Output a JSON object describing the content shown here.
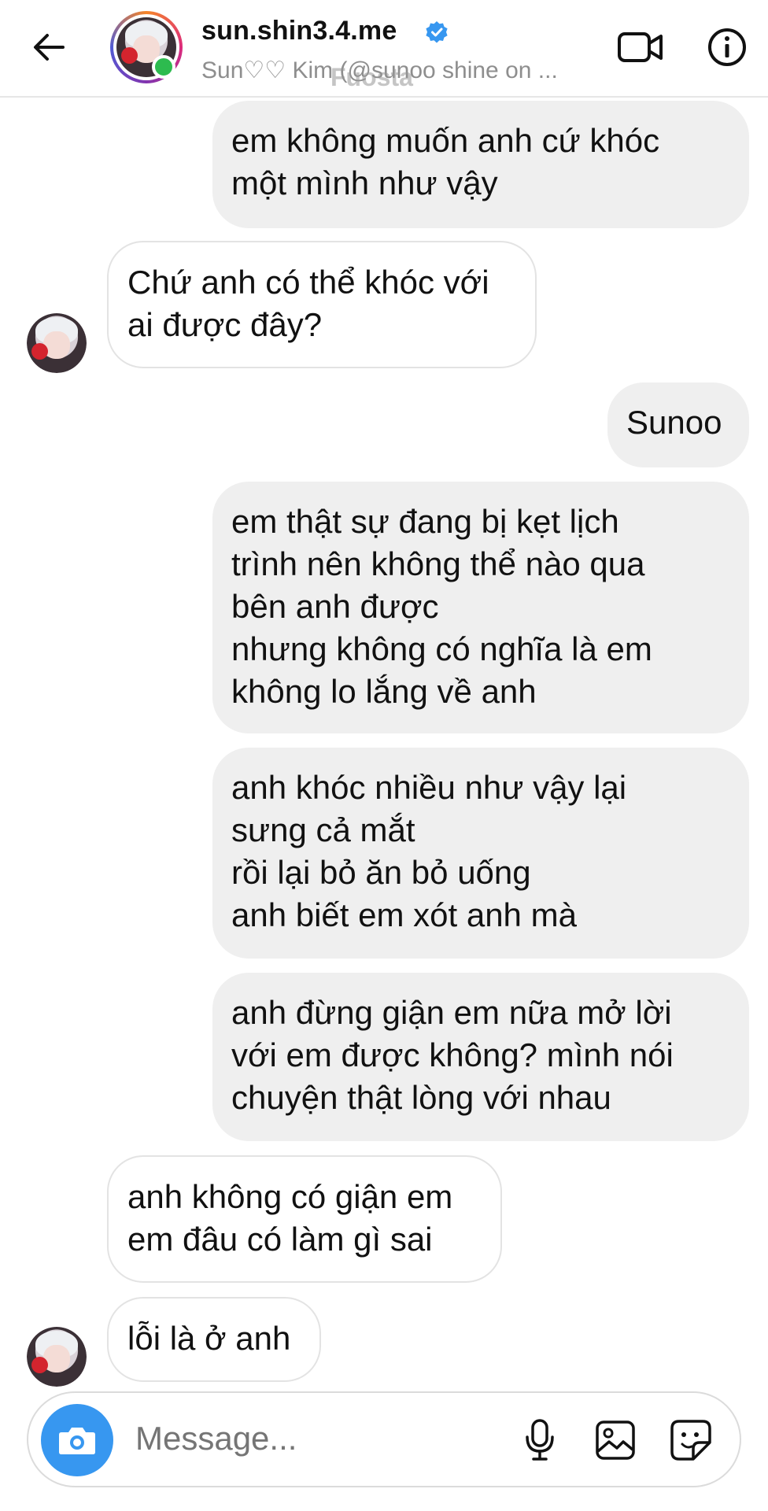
{
  "header": {
    "username": "sun.shin3.4.me",
    "subtitle": "Sun♡♡ Kim (@sunoo shine on ...",
    "watermark": "Fuosta"
  },
  "messages": [
    {
      "side": "sent",
      "text": "em không muốn anh cứ khóc\nmột mình như vậy"
    },
    {
      "side": "received",
      "text": "Chứ anh có thể khóc với\nai được đây?"
    },
    {
      "side": "sent",
      "text": "Sunoo"
    },
    {
      "side": "sent",
      "text": "em thật sự đang bị kẹt lịch\ntrình nên không thể nào qua\nbên anh được\nnhưng không có nghĩa là em\nkhông lo lắng về anh"
    },
    {
      "side": "sent",
      "text": "anh khóc nhiều như vậy lại\nsưng cả mắt\nrồi lại bỏ ăn bỏ uống\nanh biết em xót anh mà"
    },
    {
      "side": "sent",
      "text": "anh đừng giận em nữa mở lời\nvới em được không? mình nói\nchuyện thật lòng với nhau"
    },
    {
      "side": "received",
      "text": "anh không có giận em\nem đâu có làm gì sai"
    },
    {
      "side": "received",
      "text": "lỗi là ở anh"
    }
  ],
  "composer": {
    "placeholder": "Message..."
  },
  "icons": {
    "back": "arrow-left-icon",
    "verified": "verified-badge-icon",
    "video": "video-call-icon",
    "info": "info-icon",
    "camera": "camera-icon",
    "mic": "microphone-icon",
    "gallery": "image-icon",
    "sticker": "sticker-icon"
  },
  "colors": {
    "accent_blue": "#3797f0",
    "online_green": "#2dbb4f",
    "sent_bubble": "#efefef"
  }
}
